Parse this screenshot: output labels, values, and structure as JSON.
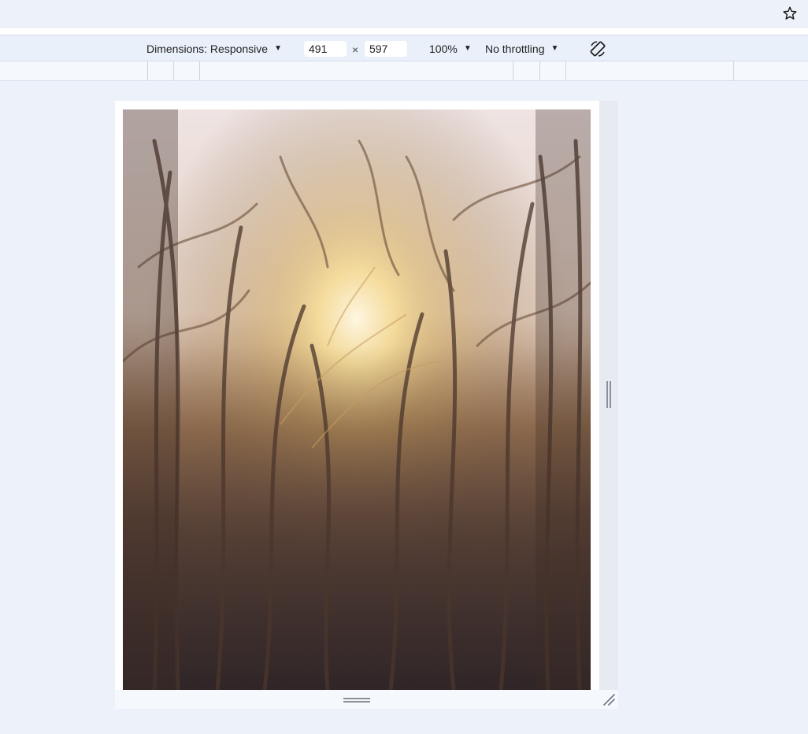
{
  "toolbar": {
    "dimensions_label": "Dimensions: Responsive",
    "width_value": "491",
    "height_value": "597",
    "times_symbol": "×",
    "zoom_label": "100%",
    "throttling_label": "No throttling",
    "caret": "▼"
  },
  "icons": {
    "star": "star-icon",
    "rotate": "rotate-icon",
    "right_grip": "vertical-resize-grip-icon",
    "bottom_grip": "horizontal-resize-grip-icon",
    "corner_grip": "corner-resize-grip-icon"
  },
  "colors": {
    "background": "#edf1f9",
    "toolbar": "#eaf0fa",
    "ruler": "#f5f8fd",
    "viewport": "#ffffff"
  }
}
